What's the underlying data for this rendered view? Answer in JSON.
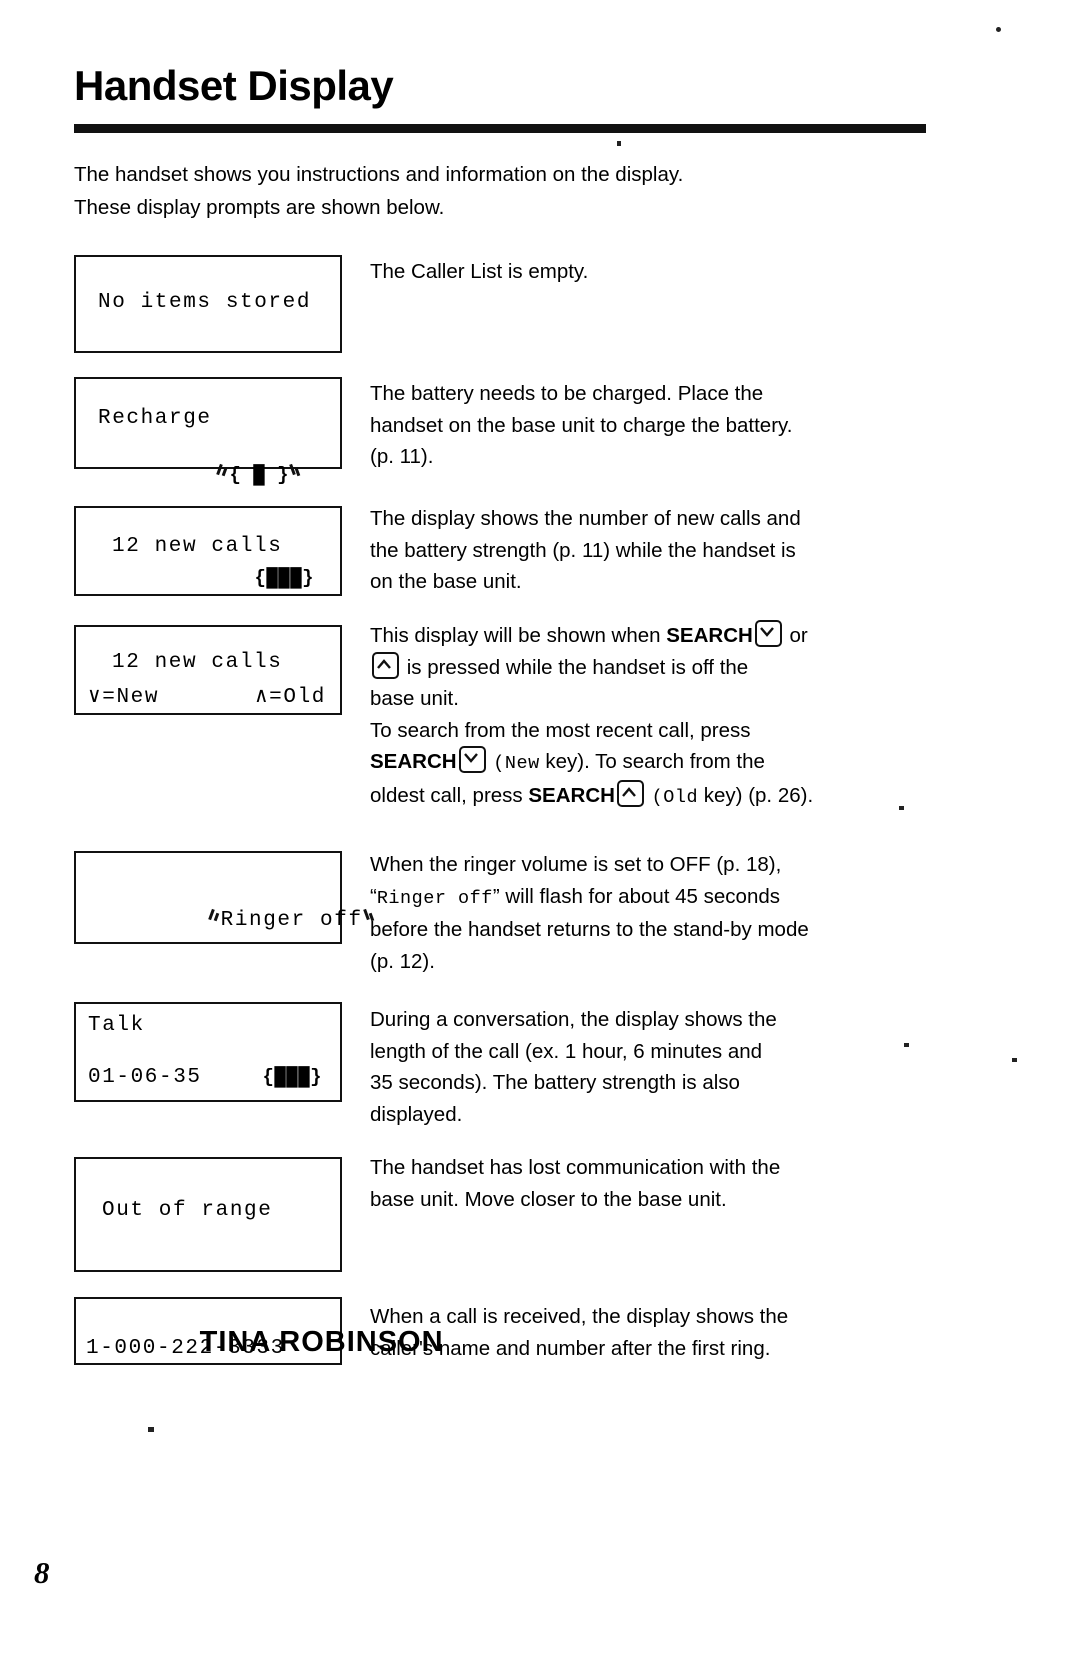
{
  "page": {
    "title": "Handset Display",
    "number": "8",
    "intro": [
      "The handset shows you instructions and information on the display.",
      "These display prompts are shown below."
    ]
  },
  "prompts": [
    {
      "id": "no-items-stored",
      "lcd": {
        "line1": "No items stored",
        "line2": "",
        "battery": ""
      },
      "description": [
        "The Caller List is empty."
      ]
    },
    {
      "id": "recharge",
      "lcd": {
        "line1": "Recharge",
        "line2": "",
        "battery": "{ █ }",
        "flashing_battery": true
      },
      "description": [
        "The battery needs to be charged. Place the",
        "handset on the base unit to charge the battery.",
        "(p. 11)."
      ]
    },
    {
      "id": "new-calls-on-base",
      "lcd": {
        "line1": "12 new calls",
        "line2": "",
        "battery": "{███}"
      },
      "description": [
        "The display shows the number of new calls and",
        "the battery strength (p. 11) while the handset is",
        "on the base unit."
      ]
    },
    {
      "id": "new-calls-search",
      "lcd": {
        "line1": "12 new calls",
        "line2_left": "∨=New",
        "line2_right": "∧=Old"
      },
      "description_parts": {
        "l1a": "This display will be shown when ",
        "l1_search": "SEARCH",
        "l1_key": "down-chevron-key-icon",
        "l1b": " or",
        "l2_key": "up-chevron-key-icon",
        "l2": " is pressed while the handset is off the",
        "l3": "base unit.",
        "l4": "To search from the most recent call, press",
        "l5_search": "SEARCH",
        "l5_key": "down-chevron-key-icon",
        "l5a": "(New",
        "l5b": " key). To search from the",
        "l6": "oldest call, press ",
        "l6_search": "SEARCH",
        "l6_key": "up-chevron-key-icon",
        "l6a": "(Old",
        "l6b": " key) (p. 26)."
      }
    },
    {
      "id": "ringer-off",
      "lcd": {
        "line1": "Ringer off",
        "flashing": true
      },
      "description_parts": {
        "l1": "When the ringer volume is set to OFF (p. 18),",
        "l2a": "“",
        "l2_mono": "Ringer off",
        "l2b": "” will flash for about 45 seconds",
        "l3": "before the handset returns to the stand-by mode",
        "l4": "(p. 12)."
      }
    },
    {
      "id": "talk",
      "lcd": {
        "line1": "Talk",
        "line2": "01-06-35",
        "battery": "{███}"
      },
      "description": [
        "During a conversation, the display shows the",
        "length of the call (ex. 1 hour, 6 minutes and",
        "35 seconds). The battery strength is also",
        "displayed."
      ]
    },
    {
      "id": "out-of-range",
      "lcd": {
        "line1": "Out of range",
        "line2": "",
        "battery": ""
      },
      "description": [
        "The handset has lost communication with the",
        "base unit. Move closer to the base unit."
      ]
    },
    {
      "id": "caller-id",
      "lcd": {
        "line1": "TINA ROBINSON",
        "line2": "1-000-222-3333"
      },
      "description": [
        "When a call is received, the display shows the",
        "caller's name and number after the first ring."
      ]
    }
  ]
}
